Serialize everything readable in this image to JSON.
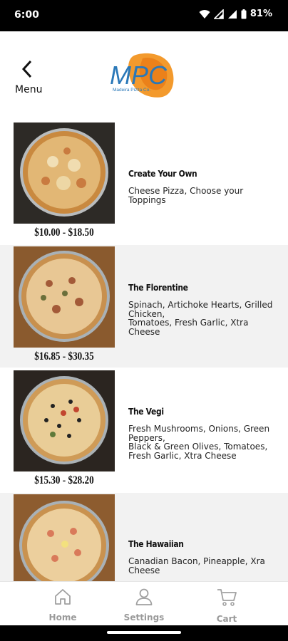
{
  "status_bar": {
    "time": "6:00",
    "battery": "81%"
  },
  "header": {
    "back_label": "Menu",
    "logo_text": "MPC"
  },
  "menu_items": [
    {
      "name": "Create Your Own",
      "description": "Cheese Pizza, Choose your\nToppings",
      "price": "$10.00 - $18.50"
    },
    {
      "name": "The Florentine",
      "description": "Spinach, Artichoke Hearts, Grilled\nChicken,\nTomatoes, Fresh Garlic, Xtra\nCheese",
      "price": "$16.85 - $30.35"
    },
    {
      "name": "The Vegi",
      "description": "Fresh Mushrooms, Onions, Green\nPeppers,\nBlack & Green Olives, Tomatoes,\nFresh Garlic, Xtra Cheese",
      "price": "$15.30 - $28.20"
    },
    {
      "name": "The Hawaiian",
      "description": "Canadian Bacon, Pineapple, Xra\nCheese",
      "price": ""
    }
  ],
  "bottom_nav": {
    "home": "Home",
    "settings": "Settings",
    "cart": "Cart"
  }
}
